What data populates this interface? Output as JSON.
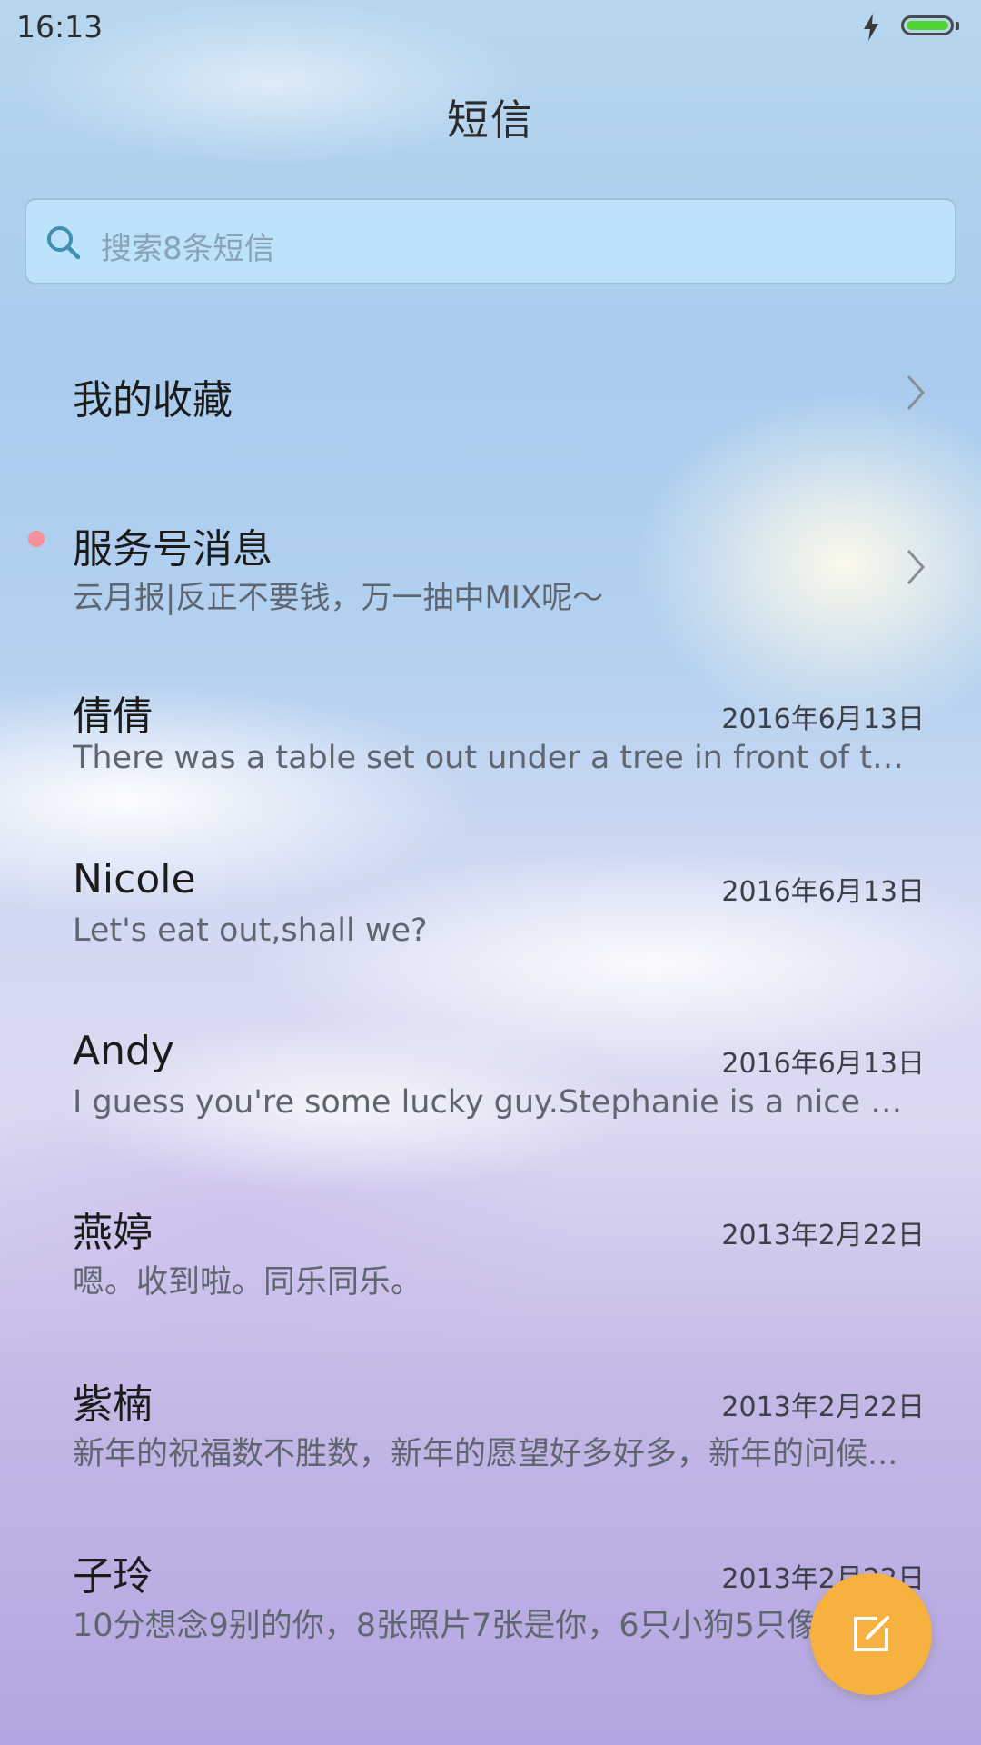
{
  "status_bar": {
    "time": "16:13",
    "battery_color": "#4fd32e"
  },
  "header": {
    "title": "短信"
  },
  "search": {
    "placeholder": "搜索8条短信"
  },
  "favorites": {
    "label": "我的收藏"
  },
  "service": {
    "title": "服务号消息",
    "subtitle": "云月报|反正不要钱，万一抽中MIX呢～",
    "unread_dot_color": "#f4909a"
  },
  "conversations": [
    {
      "name": "倩倩",
      "date": "2016年6月13日",
      "preview": "There was a table set out under a tree in front of the ho..."
    },
    {
      "name": "Nicole",
      "date": "2016年6月13日",
      "preview": "Let's eat out,shall we?"
    },
    {
      "name": "Andy",
      "date": "2016年6月13日",
      "preview": "I guess you're some lucky guy.Stephanie is a nice girl."
    },
    {
      "name": "燕婷",
      "date": "2013年2月22日",
      "preview": "嗯。收到啦。同乐同乐。"
    },
    {
      "name": "紫楠",
      "date": "2013年2月22日",
      "preview": "新年的祝福数不胜数，新年的愿望好多好多，新年的问候..."
    },
    {
      "name": "子玲",
      "date": "2013年2月22日",
      "preview": "10分想念9别的你，8张照片7张是你，6只小狗5只像你"
    }
  ],
  "fab": {
    "icon": "compose-icon",
    "color": "#f7b13f"
  }
}
